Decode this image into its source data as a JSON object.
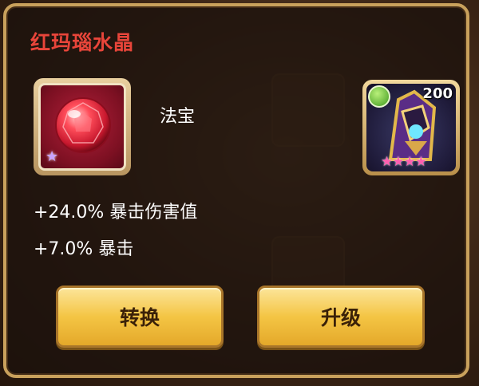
{
  "item": {
    "name": "红玛瑙水晶",
    "category": "法宝",
    "gem_color": "#c8182e",
    "rarity_star": "★"
  },
  "hero": {
    "level": "200",
    "element_icon": "leaf-element-icon",
    "stars": "★★★★",
    "star_count": 4
  },
  "stats": [
    "+24.0% 暴击伤害值",
    "+7.0% 暴击"
  ],
  "buttons": {
    "convert": "转换",
    "upgrade": "升级"
  },
  "colors": {
    "title": "#e8453a",
    "button": "#f4c544",
    "frame": "#c9a15c"
  }
}
